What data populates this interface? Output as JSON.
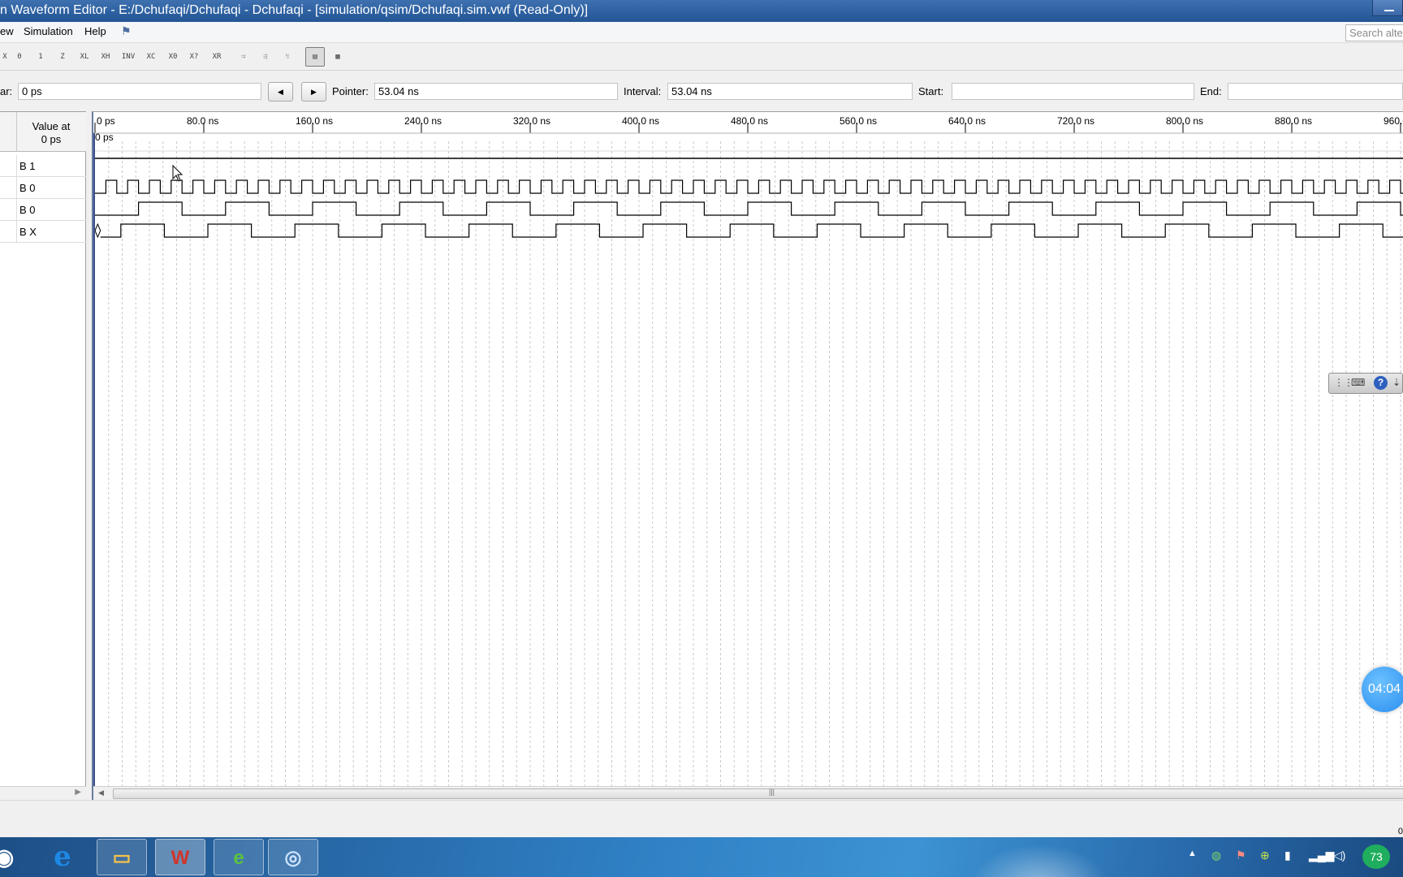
{
  "window": {
    "title": "n Waveform Editor - E:/Dchufaqi/Dchufaqi - Dchufaqi - [simulation/qsim/Dchufaqi.sim.vwf (Read-Only)]"
  },
  "menu": {
    "items": [
      "ew",
      "Simulation",
      "Help"
    ],
    "search_placeholder": "Search alte"
  },
  "toolbar": {
    "buttons": [
      {
        "glyph": "X",
        "icon": "overwrite-unknown-icon"
      },
      {
        "glyph": "0",
        "icon": "force-low-icon"
      },
      {
        "glyph": "1",
        "icon": "force-high-icon"
      },
      {
        "glyph": "Z",
        "icon": "high-impedance-icon"
      },
      {
        "glyph": "XL",
        "icon": "weak-low-icon"
      },
      {
        "glyph": "XH",
        "icon": "weak-high-icon"
      },
      {
        "glyph": "INV",
        "icon": "invert-icon"
      },
      {
        "glyph": "XC",
        "icon": "count-value-icon"
      },
      {
        "glyph": "X0",
        "icon": "overwrite-clock-icon"
      },
      {
        "glyph": "X?",
        "icon": "arbitrary-value-icon"
      },
      {
        "glyph": "XR",
        "icon": "random-values-icon"
      },
      {
        "glyph": "⇉",
        "icon": "snap-to-grid-icon"
      },
      {
        "glyph": "⇶",
        "icon": "sort-icon"
      },
      {
        "glyph": "↯",
        "icon": "regroup-icon"
      },
      {
        "glyph": "▤",
        "icon": "waveform-view-icon"
      },
      {
        "glyph": "▦",
        "icon": "grid-settings-icon"
      }
    ]
  },
  "cursors": {
    "master_label": "ar:",
    "master_value": "0 ps",
    "prev_glyph": "◀",
    "next_glyph": "▶",
    "pointer_label": "Pointer:",
    "pointer_value": "53.04 ns",
    "interval_label": "Interval:",
    "interval_value": "53.04 ns",
    "start_label": "Start:",
    "start_value": "",
    "end_label": "End:",
    "end_value": ""
  },
  "value_column": {
    "header_line1": "Value at",
    "header_line2": "0 ps"
  },
  "signals": [
    {
      "value": "B 1",
      "type": "constant",
      "level": 1
    },
    {
      "value": "B 0",
      "type": "clock",
      "half_period_ns": 8
    },
    {
      "value": "B 0",
      "type": "clock",
      "half_period_ns": 32
    },
    {
      "value": "B X",
      "type": "output",
      "half_period_ns": 32,
      "first_edge_ns": 19,
      "undefined_until_ns": 2
    }
  ],
  "timeline": {
    "ticks": [
      "0 ps",
      "80.0 ns",
      "160.0 ns",
      "240.0 ns",
      "320.0 ns",
      "400.0 ns",
      "480.0 ns",
      "560.0 ns",
      "640.0 ns",
      "720.0 ns",
      "800.0 ns",
      "880.0 ns",
      "960.0"
    ],
    "tick_step_ns": 80,
    "cursor_label": "0 ps",
    "grid_step_ns": 10
  },
  "scrollbar": {
    "grip": "|||"
  },
  "status_right": "0",
  "floating_toolbar": {
    "help": "?"
  },
  "timer": "04:04",
  "taskbar": {
    "apps": [
      {
        "icon": "internet-explorer-icon",
        "glyph": "e"
      },
      {
        "icon": "file-explorer-icon",
        "glyph": "▭"
      },
      {
        "icon": "wps-office-icon",
        "glyph": "W"
      },
      {
        "icon": "browser-icon",
        "glyph": "e"
      },
      {
        "icon": "quartus-icon",
        "glyph": "◎"
      }
    ],
    "tray_badge": "73"
  },
  "colors": {
    "title_bar": "#2c5f9f",
    "wave_line": "#000000",
    "taskbar": "#2f7fc4",
    "timer": "#2a8ef0"
  }
}
